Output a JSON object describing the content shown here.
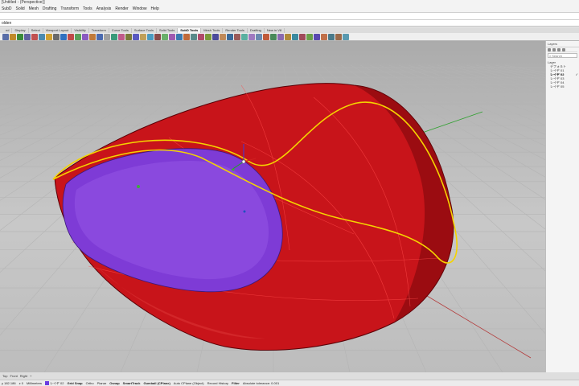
{
  "window": {
    "title": "[Untitled - (Perspective)]"
  },
  "menu": [
    "SubD",
    "Solid",
    "Mesh",
    "Drafting",
    "Transform",
    "Tools",
    "Analysis",
    "Render",
    "Window",
    "Help"
  ],
  "command": {
    "prompt": "olden"
  },
  "tabs": {
    "active_index": 9,
    "items": [
      "nd",
      "Display",
      "Select",
      "Viewport Layout",
      "Visibility",
      "Transform",
      "Curve Tools",
      "Surface Tools",
      "Solid Tools",
      "SubD Tools",
      "Mesh Tools",
      "Render Tools",
      "Drafting",
      "New in V8"
    ]
  },
  "toolbar": {
    "colors": [
      "#5a6ea8",
      "#c08a2a",
      "#3a8a3a",
      "#6060a0",
      "#c05050",
      "#4a8ab0",
      "#d0a030",
      "#6a6a6a",
      "#3070c0",
      "#c04a4a",
      "#5aa05a",
      "#8a5ac0",
      "#c07a3a",
      "#4a6ab0",
      "#a0a0a0",
      "#3a9a7a",
      "#c05a8a",
      "#7a7a3a",
      "#5a5ac0",
      "#c0a05a",
      "#4a9ac0",
      "#8a4a4a",
      "#6ab06a",
      "#a05ab0",
      "#3a7ab0",
      "#c06a3a",
      "#5a8a8a",
      "#b04a6a",
      "#7a9a3a",
      "#4a4a9a",
      "#c08a5a",
      "#3a6a9a",
      "#9a5a5a",
      "#5ab0a0",
      "#a07ac0",
      "#6a8ab0",
      "#c05a3a",
      "#4a8a5a",
      "#8a6ab0",
      "#b08a3a",
      "#3a8aa0",
      "#a04a5a",
      "#6aa04a",
      "#5a4ab0",
      "#c0704a",
      "#4a7a8a",
      "#9a6a4a",
      "#5a9ab0"
    ]
  },
  "viewport": {
    "label": ""
  },
  "panel": {
    "title": "Layers",
    "search_placeholder": "Search",
    "header": "Layer",
    "layers": [
      {
        "name": "デフォルト",
        "current": false
      },
      {
        "name": "レイヤ 01",
        "current": false
      },
      {
        "name": "レイヤ 02",
        "current": true
      },
      {
        "name": "レイヤ 03",
        "current": false
      },
      {
        "name": "レイヤ 04",
        "current": false
      },
      {
        "name": "レイヤ 05",
        "current": false
      }
    ],
    "current_mark": "✓"
  },
  "view_tabs": [
    "Top",
    "Front",
    "Right",
    "+"
  ],
  "status": {
    "coords": "y 182.186",
    "z": "z 0",
    "units": "Millimeters",
    "layer": "レイヤ 02",
    "toggles": [
      {
        "label": "Grid Snap",
        "on": true
      },
      {
        "label": "Ortho",
        "on": false
      },
      {
        "label": "Planar",
        "on": false
      },
      {
        "label": "Osnap",
        "on": true
      },
      {
        "label": "SmartTrack",
        "on": true
      },
      {
        "label": "Gumball (CPlane)",
        "on": true
      },
      {
        "label": "Auto CPlane (Object)",
        "on": false
      },
      {
        "label": "Record History",
        "on": false
      },
      {
        "label": "Filter",
        "on": true
      }
    ],
    "tolerance": "Absolute tolerance: 0.001"
  },
  "colors": {
    "body_red": "#c8141a",
    "top_face": "#7e3bd6",
    "edge_curve": "#f5d300",
    "axis_green": "#2fa12f",
    "axis_red": "#b33a3a"
  }
}
